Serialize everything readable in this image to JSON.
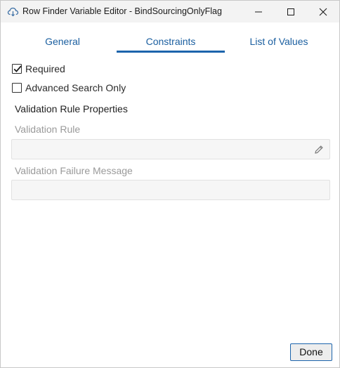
{
  "window": {
    "title": "Row Finder Variable Editor - BindSourcingOnlyFlag",
    "icon": "cloud-app-icon",
    "controls": [
      "minimize-icon",
      "maximize-icon",
      "close-icon"
    ]
  },
  "tabs": [
    {
      "label": "General",
      "active": false
    },
    {
      "label": "Constraints",
      "active": true
    },
    {
      "label": "List of Values",
      "active": false
    }
  ],
  "options": {
    "required": {
      "label": "Required",
      "checked": true
    },
    "advanced_search_only": {
      "label": "Advanced Search Only",
      "checked": false
    }
  },
  "validation": {
    "section_title": "Validation Rule Properties",
    "rule_label": "Validation Rule",
    "rule_value": "",
    "failure_message_label": "Validation Failure Message",
    "failure_message_value": ""
  },
  "footer": {
    "done_label": "Done"
  },
  "colors": {
    "accent": "#1c64ac",
    "tab_text": "#1b5fa0",
    "disabled_text": "#9a9a9a",
    "field_bg": "#f6f6f6",
    "titlebar_bg": "#f3f3f3"
  }
}
